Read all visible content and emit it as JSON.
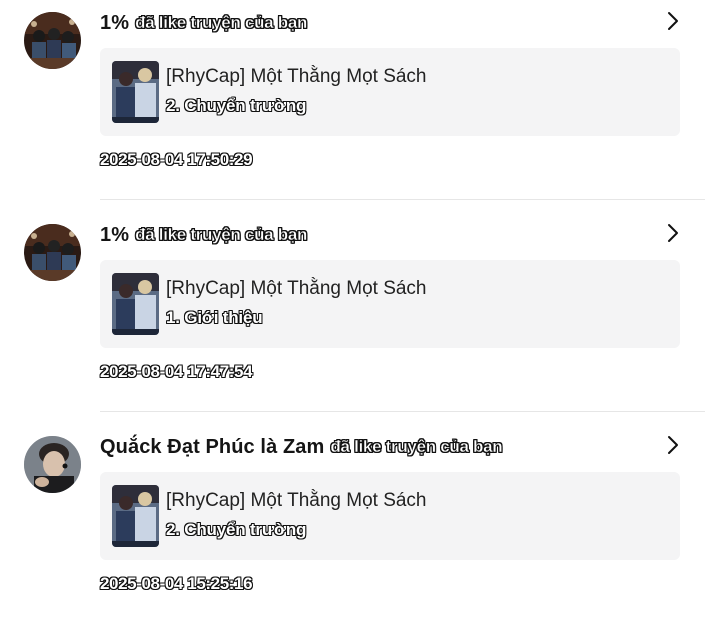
{
  "notifications": [
    {
      "user_name": "1%",
      "action": "đã like truyện của bạn",
      "avatar_icon": "group-photo-avatar",
      "story_title": "[RhyCap] Một Thằng Mọt Sách",
      "chapter": "2. Chuyển trường",
      "timestamp": "2025-08-04 17:50:29"
    },
    {
      "user_name": "1%",
      "action": "đã like truyện của bạn",
      "avatar_icon": "group-photo-avatar",
      "story_title": "[RhyCap] Một Thằng Mọt Sách",
      "chapter": "1. Giới thiệu",
      "timestamp": "2025-08-04 17:47:54"
    },
    {
      "user_name": "Quắck Đạt Phúc là Zam",
      "action": "đã like truyện của bạn",
      "avatar_icon": "portrait-avatar",
      "story_title": "[RhyCap] Một Thằng Mọt Sách",
      "chapter": "2. Chuyển trường",
      "timestamp": "2025-08-04 15:25:16"
    }
  ],
  "icons": {
    "chevron": "chevron-right-icon",
    "cover": "story-cover-image"
  },
  "colors": {
    "card_background": "#f4f4f5",
    "divider": "#e6e6e6",
    "text_primary": "#151515"
  }
}
